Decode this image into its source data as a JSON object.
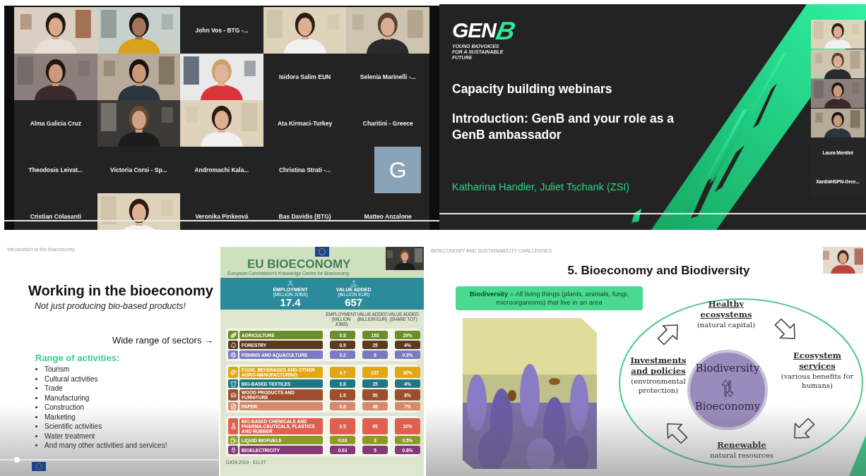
{
  "video_call": {
    "tiles": [
      {
        "kind": "picture"
      },
      {
        "kind": "picture"
      },
      {
        "kind": "name",
        "name": "John Vos - BTG -..."
      },
      {
        "kind": "picture"
      },
      {
        "kind": "picture"
      },
      {
        "kind": "picture"
      },
      {
        "kind": "picture"
      },
      {
        "kind": "picture"
      },
      {
        "kind": "name",
        "name": "Isidora Salim EUN"
      },
      {
        "kind": "name",
        "name": "Selenia Marinelli -..."
      },
      {
        "kind": "name",
        "name": "Alma Galicia Cruz"
      },
      {
        "kind": "picture"
      },
      {
        "kind": "picture"
      },
      {
        "kind": "name",
        "name": "Ata Kirmaci-Turkey"
      },
      {
        "kind": "name",
        "name": "Charitini - Greece"
      },
      {
        "kind": "name",
        "name": "Theodosis Leivat..."
      },
      {
        "kind": "name",
        "name": "Victoria Corsi - Sp..."
      },
      {
        "kind": "name",
        "name": "Andromachi Kala..."
      },
      {
        "kind": "name",
        "name": "Christina Strati -..."
      },
      {
        "kind": "avatar",
        "letter": "G"
      },
      {
        "kind": "name",
        "name": "Cristian Colasanti"
      },
      {
        "kind": "picture"
      },
      {
        "kind": "name",
        "name": "Veronika Pinkeová"
      },
      {
        "kind": "name",
        "name": "Bas Davidis (BTG)"
      },
      {
        "kind": "name",
        "name": "Matteo Anzalone"
      }
    ]
  },
  "title_slide": {
    "logo": {
      "name": "GEN",
      "mark": "B",
      "tagline": [
        "YOUNG BIOVOICES",
        "FOR A SUSTAINABLE",
        "FUTURE"
      ]
    },
    "title": "Capacity building webinars",
    "subtitle": "Introduction: GenB and your role as a GenB ambassador",
    "presenters": "Katharina Handler, Juliet Tschank (ZSI)",
    "participants": [
      {
        "kind": "picture"
      },
      {
        "kind": "picture"
      },
      {
        "kind": "picture"
      },
      {
        "kind": "picture"
      },
      {
        "kind": "name",
        "name": "Laura Mentini"
      },
      {
        "kind": "name",
        "name": "XanthiHSPN-Gree..."
      }
    ]
  },
  "bioeconomy_slide": {
    "header": "Introduction to the bioeconomy",
    "title": "Working in the bioeconomy",
    "subtitle": "Not just producing bio-based products!",
    "sectors_note": "Wide range of sectors →",
    "activities_heading": "Range of activities:",
    "activities": [
      "Tourism",
      "Cultural activities",
      "Trade",
      "Manufacturing",
      "Construction",
      "Marketing",
      "Scientific activities",
      "Water treatment",
      "And many other activities and services!"
    ]
  },
  "infographic": {
    "title": "EU BIOECONOMY",
    "subtitle": "European Commission's Knowledge Centre for Bioeconomy",
    "totals": [
      {
        "label": "EMPLOYMENT",
        "unit": "(MILLION JOBS)",
        "value": "17.4"
      },
      {
        "label": "VALUE ADDED",
        "unit": "(BILLION EUR)",
        "value": "657"
      }
    ],
    "columns": [
      "EMPLOYMENT (MILLION JOBS)",
      "VALUE ADDED (BILLION EUR)",
      "VALUE ADDED (SHARE TOT)"
    ],
    "groups": [
      {
        "rows": [
          {
            "sector": "AGRICULTURE",
            "employment": "0.8",
            "value_added": "193",
            "share": "29%",
            "color": "#6b8e2b"
          },
          {
            "sector": "FORESTRY",
            "employment": "0.5",
            "value_added": "25",
            "share": "4%",
            "color": "#5c3a22"
          },
          {
            "sector": "FISHING AND AQUACULTURE",
            "employment": "0.2",
            "value_added": "6",
            "share": "0.9%",
            "color": "#7b79c2"
          }
        ]
      },
      {
        "rows": [
          {
            "sector": "FOOD, BEVERAGES AND OTHER AGRO-MANUFACTURING",
            "employment": "4.7",
            "value_added": "237",
            "share": "36%",
            "color": "#e0a817"
          },
          {
            "sector": "BIO-BASED TEXTILES",
            "employment": "0.8",
            "value_added": "25",
            "share": "4%",
            "color": "#1f7786"
          },
          {
            "sector": "WOOD PRODUCTS AND FURNITURE",
            "employment": "1.5",
            "value_added": "50",
            "share": "8%",
            "color": "#9c4f2c"
          },
          {
            "sector": "PAPER",
            "employment": "0.6",
            "value_added": "48",
            "share": "7%",
            "color": "#d58a6c"
          }
        ]
      },
      {
        "rows": [
          {
            "sector": "BIO-BASED CHEMICALS AND PHARMA-CEUTICALS, PLASTICS AND RUBBER",
            "employment": "0.5",
            "value_added": "65",
            "share": "10%",
            "color": "#e0604f"
          },
          {
            "sector": "LIQUID BIOFUELS",
            "employment": "0.03",
            "value_added": "3",
            "share": "0.5%",
            "color": "#8c9b22"
          },
          {
            "sector": "BIOELECTRICITY",
            "employment": "0.03",
            "value_added": "5",
            "share": "0.8%",
            "color": "#86397a"
          }
        ]
      }
    ],
    "footer": "DATA 2019 · EU-27"
  },
  "biodiversity_slide": {
    "header": "BIOECONOMY AND SUSTAINABILITY CHALLENGES",
    "title": "5. Bioeconomy and Biodiversity",
    "definition": "**Biodiversity** = All living things (plants, animals, fungi, microorganisms) that live in an area",
    "center": [
      "Biodiversity",
      "Bioeconomy"
    ],
    "cycle": [
      {
        "heading": "Healthy ecosystems",
        "note": "(natural capital)"
      },
      {
        "heading": "Ecosystem services",
        "note": "(various benefits for humans)"
      },
      {
        "heading": "Renewable",
        "note": "natural resources"
      },
      {
        "heading": "**Investments** and **policies**",
        "note": "(environmental protection)"
      }
    ]
  }
}
